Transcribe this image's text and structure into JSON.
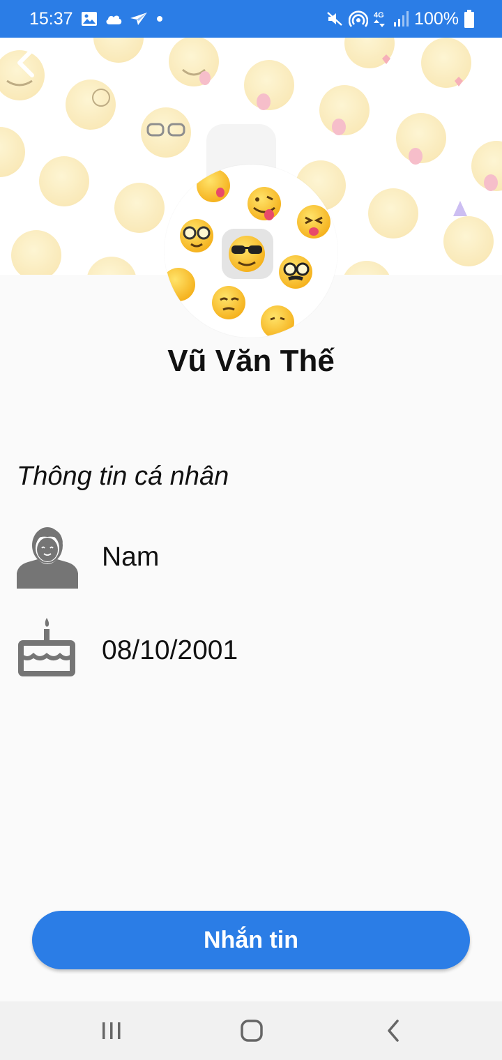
{
  "status_bar": {
    "time": "15:37",
    "battery": "100%",
    "network": "4G",
    "left_icons": [
      "gallery-icon",
      "cloud-icon",
      "send-icon",
      "dot-icon"
    ],
    "right_icons": [
      "mute-icon",
      "hotspot-icon",
      "network-4g-icon",
      "signal-icon",
      "battery-icon"
    ]
  },
  "header": {
    "back_icon": "back-chevron-icon"
  },
  "profile": {
    "name": "Vũ Văn Thế"
  },
  "personal_info": {
    "title": "Thông tin cá nhân",
    "gender": "Nam",
    "gender_icon": "male-user-icon",
    "birthday": "08/10/2001",
    "birthday_icon": "birthday-cake-icon"
  },
  "actions": {
    "message_label": "Nhắn tin"
  },
  "nav_bar": {
    "icons": [
      "recent-apps-icon",
      "home-icon",
      "back-icon"
    ]
  },
  "colors": {
    "primary": "#2b7de6",
    "text": "#111111",
    "icon_gray": "#757575",
    "background": "#fafafa"
  }
}
